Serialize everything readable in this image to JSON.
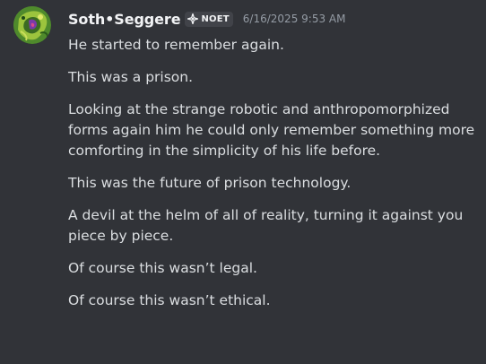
{
  "author": {
    "name": "Soth•Seggere",
    "tag": "NOET",
    "tag_icon": "diamond-sparkle-icon",
    "avatar_icon": "avatar-image"
  },
  "timestamp": "6/16/2025 9:53 AM",
  "colors": {
    "background": "#313338",
    "text": "#dbdee1",
    "username": "#f2f3f5",
    "timestamp": "#949ba4",
    "tag_background": "#414349"
  },
  "messages": [
    "He started to remember again.",
    "This was a prison.",
    "Looking at the strange robotic and anthropomorphized forms again him he could only remember something more comforting in the simplicity of his life before.",
    "This was the future of prison technology.",
    "A devil at the helm of all of reality, turning it against you piece by piece.",
    "Of course this wasn’t legal.",
    "Of course this wasn’t ethical."
  ]
}
